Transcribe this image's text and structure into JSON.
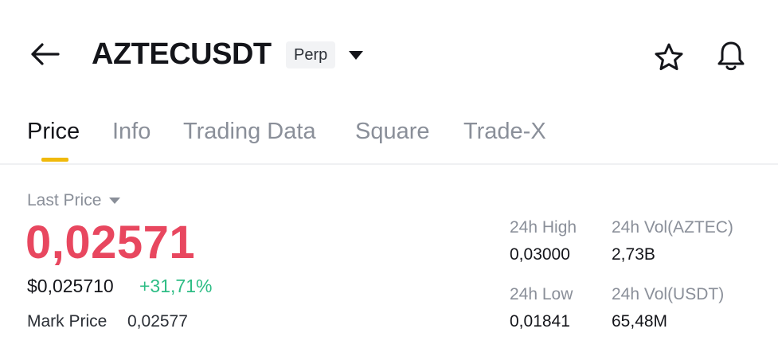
{
  "header": {
    "symbol": "AZTECUSDT",
    "contract_type": "Perp",
    "icons": {
      "back": "arrow-left-icon",
      "dropdown": "caret-down-icon",
      "favorite": "star-icon",
      "alert": "bell-icon"
    }
  },
  "tabs": [
    {
      "label": "Price",
      "active": true
    },
    {
      "label": "Info",
      "active": false
    },
    {
      "label": "Trading Data",
      "active": false
    },
    {
      "label": "Square",
      "active": false
    },
    {
      "label": "Trade-X",
      "active": false
    }
  ],
  "price": {
    "last_price_label": "Last Price",
    "last_price": "0,02571",
    "usd_price": "$0,025710",
    "change_percent": "+31,71%",
    "mark_price_label": "Mark Price",
    "mark_price": "0,02577"
  },
  "stats": {
    "high_label": "24h High",
    "high_value": "0,03000",
    "vol_base_label": "24h Vol(AZTEC)",
    "vol_base_value": "2,73B",
    "low_label": "24h Low",
    "low_value": "0,01841",
    "vol_quote_label": "24h Vol(USDT)",
    "vol_quote_value": "65,48M"
  },
  "colors": {
    "accent": "#f0b90b",
    "down_red": "#e8475f",
    "up_green": "#2ebd85",
    "text_primary": "#14151a",
    "text_secondary": "#8a8f99"
  }
}
